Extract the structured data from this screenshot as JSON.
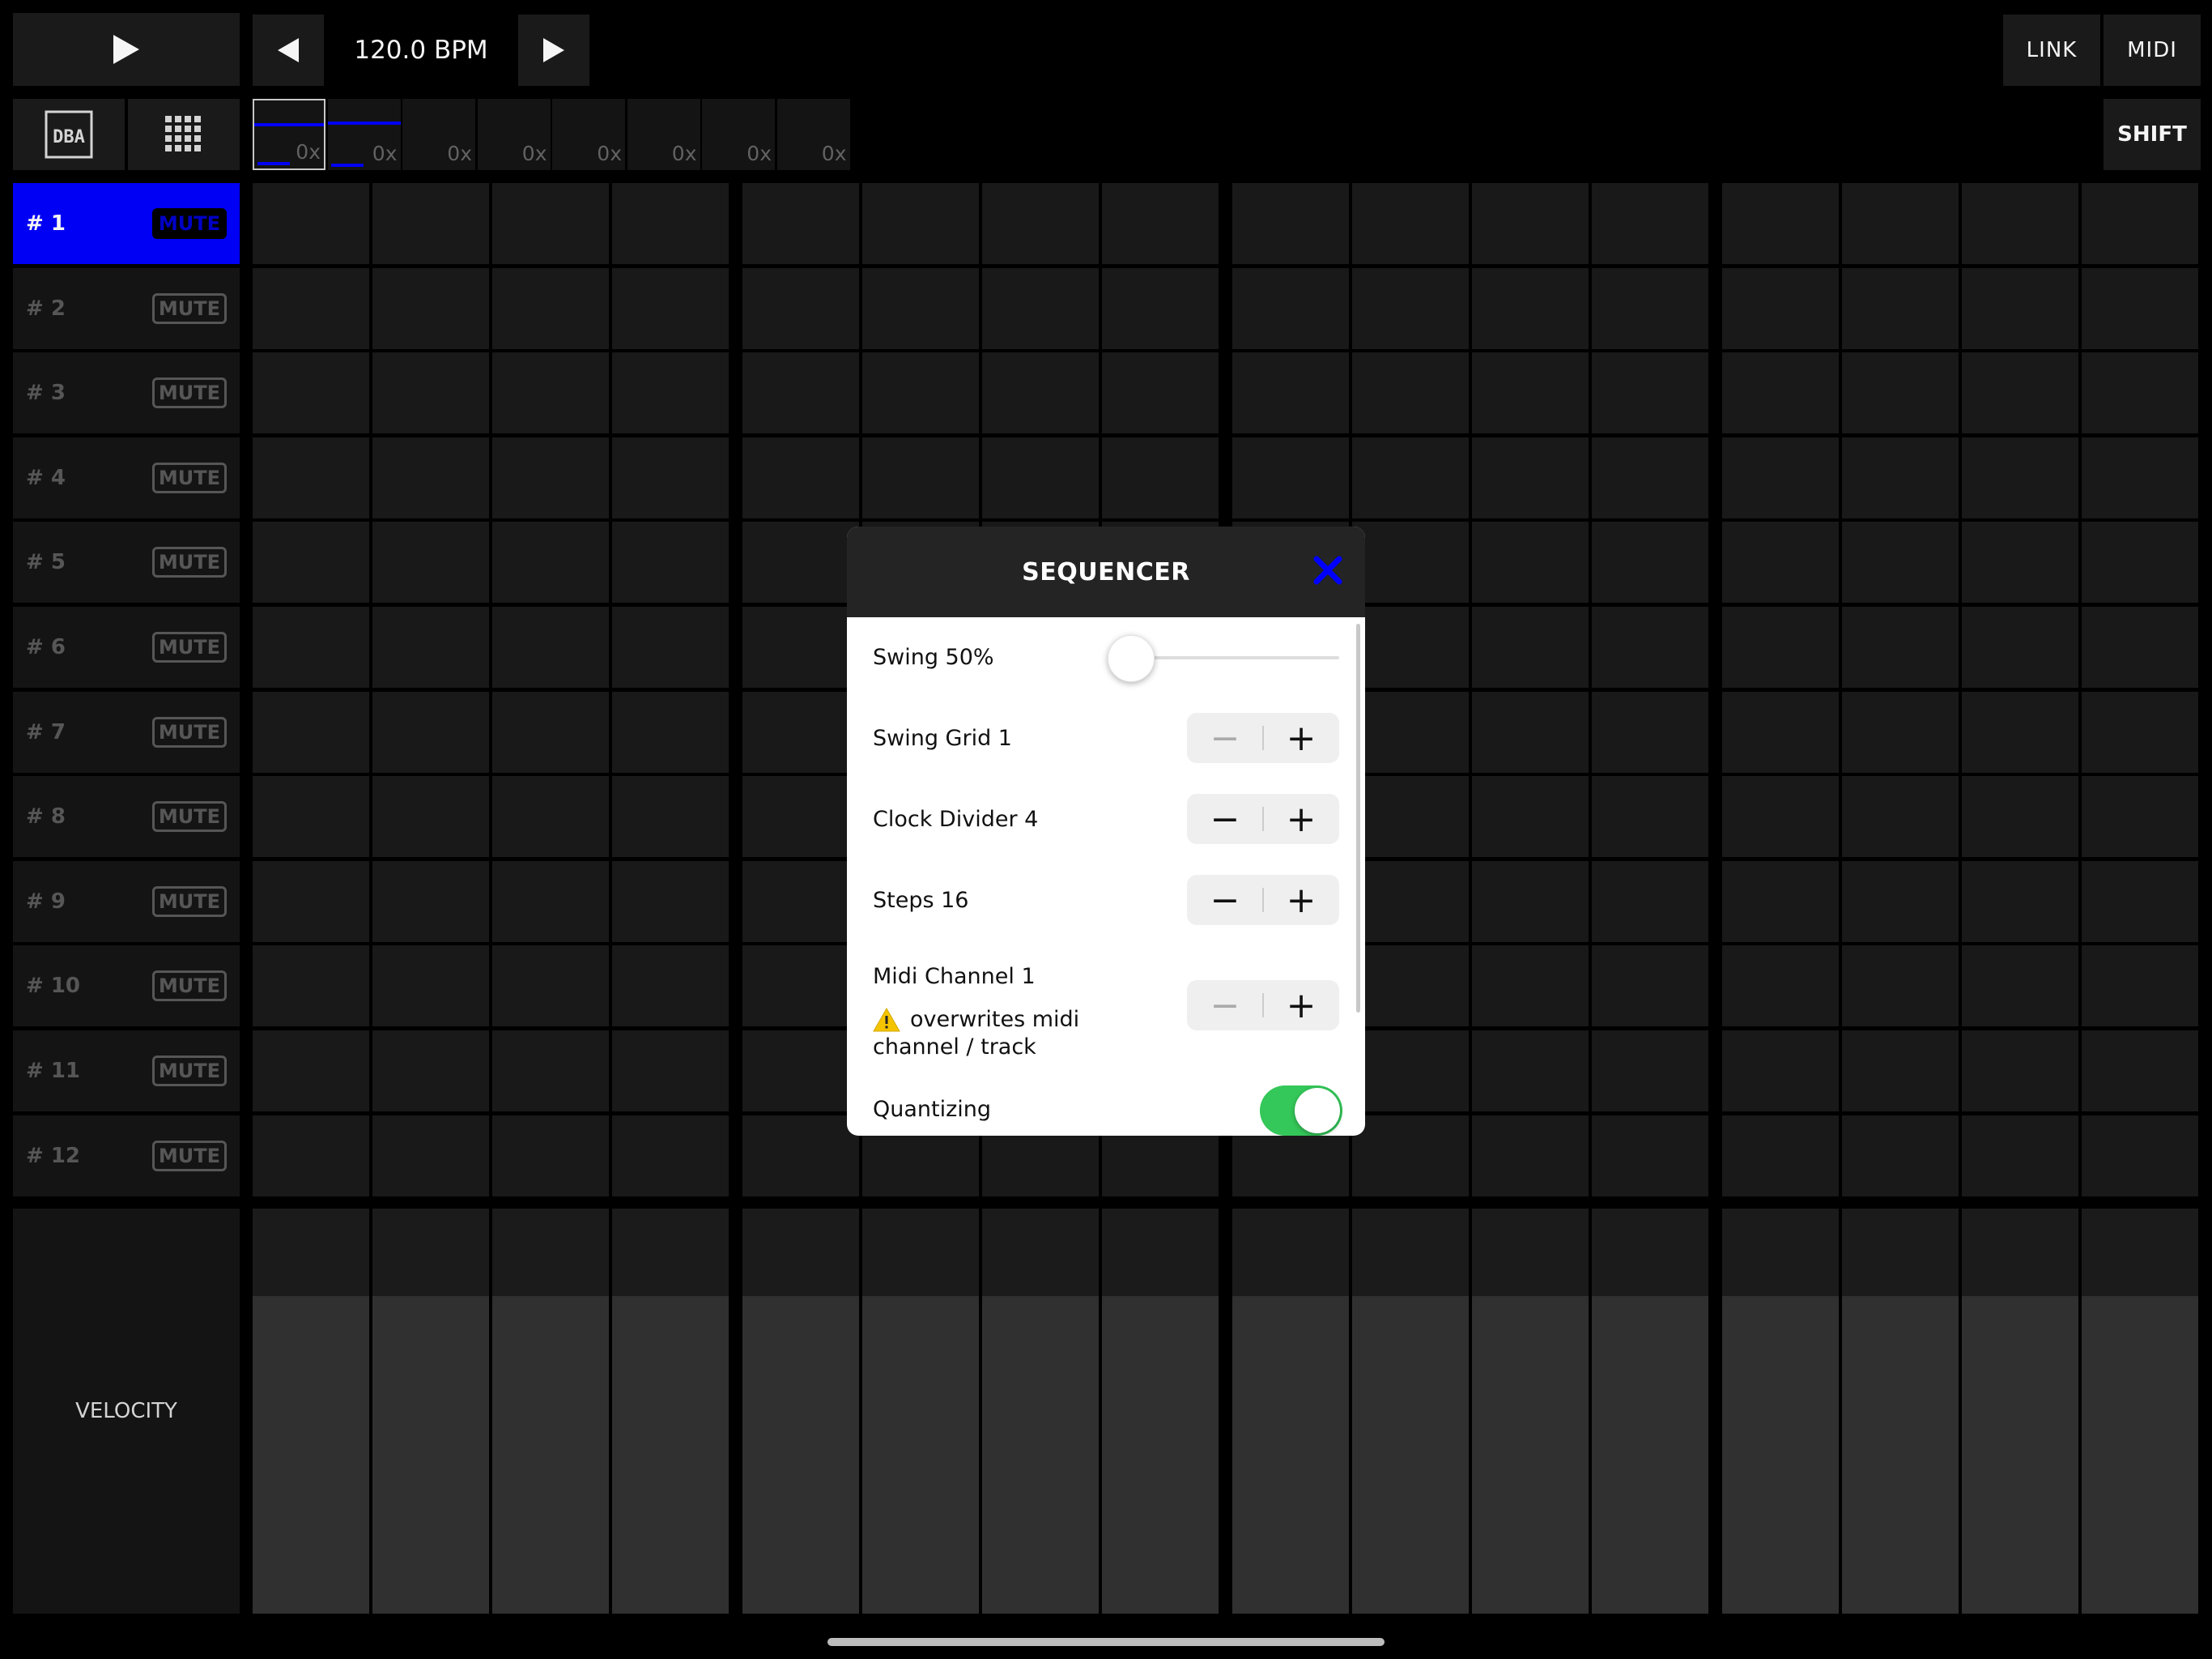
{
  "transport": {
    "play_icon": "play-icon",
    "bpm": "120.0 BPM",
    "link": "LINK",
    "midi": "MIDI",
    "shift": "SHIFT"
  },
  "patterns": [
    "0x",
    "0x",
    "0x",
    "0x",
    "0x",
    "0x",
    "0x",
    "0x"
  ],
  "tracks": [
    {
      "num": "# 1",
      "mute": "MUTE",
      "active": true
    },
    {
      "num": "# 2",
      "mute": "MUTE"
    },
    {
      "num": "# 3",
      "mute": "MUTE"
    },
    {
      "num": "# 4",
      "mute": "MUTE"
    },
    {
      "num": "# 5",
      "mute": "MUTE"
    },
    {
      "num": "# 6",
      "mute": "MUTE"
    },
    {
      "num": "# 7",
      "mute": "MUTE"
    },
    {
      "num": "# 8",
      "mute": "MUTE"
    },
    {
      "num": "# 9",
      "mute": "MUTE"
    },
    {
      "num": "# 10",
      "mute": "MUTE"
    },
    {
      "num": "# 11",
      "mute": "MUTE"
    },
    {
      "num": "# 12",
      "mute": "MUTE"
    }
  ],
  "velocity_label": "VELOCITY",
  "sequencer": {
    "title": "SEQUENCER",
    "swing_label": "Swing 50%",
    "swing_value": 0.5,
    "swing_grid_label": "Swing Grid 1",
    "clock_divider_label": "Clock Divider 4",
    "steps_label": "Steps 16",
    "midi_channel_label": "Midi Channel 1",
    "warning_text": "overwrites midi channel / track",
    "quantizing_label": "Quantizing",
    "quantizing_on": true
  },
  "colors": {
    "accent": "#0000ff",
    "toggle_on": "#34c759"
  }
}
